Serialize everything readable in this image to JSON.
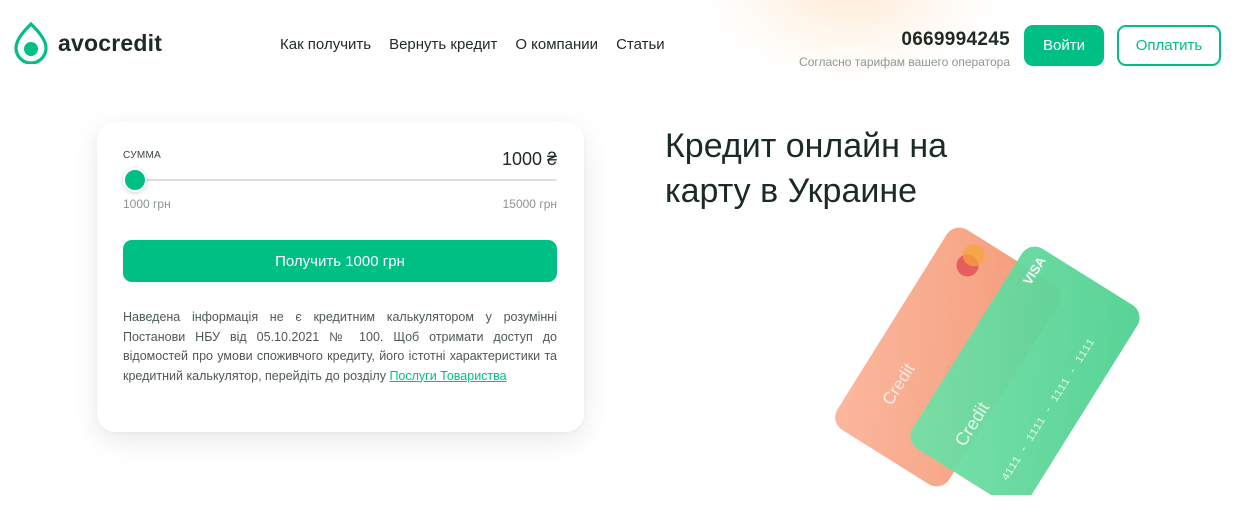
{
  "header": {
    "logo_text": "avocredit",
    "nav": [
      "Как получить",
      "Вернуть кредит",
      "О компании",
      "Статьи"
    ],
    "phone": "0669994245",
    "phone_note": "Согласно тарифам вашего оператора",
    "login_label": "Войти",
    "pay_label": "Оплатить"
  },
  "calculator": {
    "sum_label": "СУММА",
    "sum_value": "1000 ₴",
    "min_label": "1000 грн",
    "max_label": "15000 грн",
    "slider_fraction": 0.0,
    "cta_label": "Получить 1000 грн",
    "disclaimer_text": "Наведена інформація не є кредитним калькулятором у розумінні Постанови НБУ від 05.10.2021 № 100. Щоб отримати доступ до відомостей про умови споживчого кредиту, його істотні характеристики та кредитний калькулятор, перейдіть до розділу ",
    "disclaimer_link": "Послуги Товариства"
  },
  "hero": {
    "title": "Кредит онлайн на карту в Украине"
  },
  "cards": {
    "back_card_text": "Credit",
    "front_card_text": "Credit",
    "front_card_brand": "VISA",
    "front_card_number": "4111 - 1111 - 1111 - 1111"
  },
  "colors": {
    "accent": "#00bf85",
    "card_coral": "#f7a186",
    "card_green": "#5fd89c"
  }
}
